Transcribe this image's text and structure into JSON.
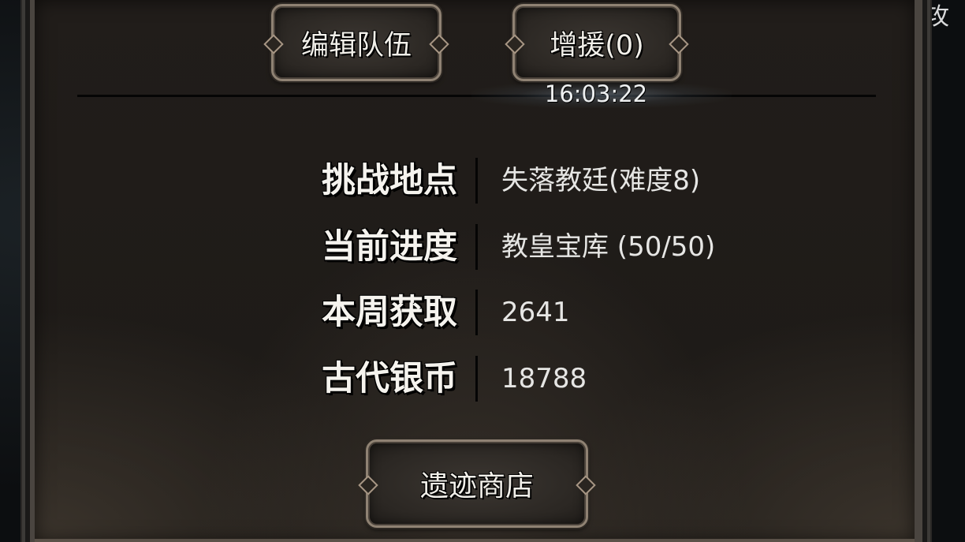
{
  "top_buttons": {
    "edit_team": "编辑队伍",
    "reinforce": "增援(0)"
  },
  "timer": "16:03:22",
  "info_rows": [
    {
      "label": "挑战地点",
      "value": "失落教廷(难度8)"
    },
    {
      "label": "当前进度",
      "value": "教皇宝库 (50/50)"
    },
    {
      "label": "本周获取",
      "value": "2641"
    },
    {
      "label": "古代银币",
      "value": "18788"
    }
  ],
  "shop_button": "遗迹商店",
  "edge_text": "攻"
}
